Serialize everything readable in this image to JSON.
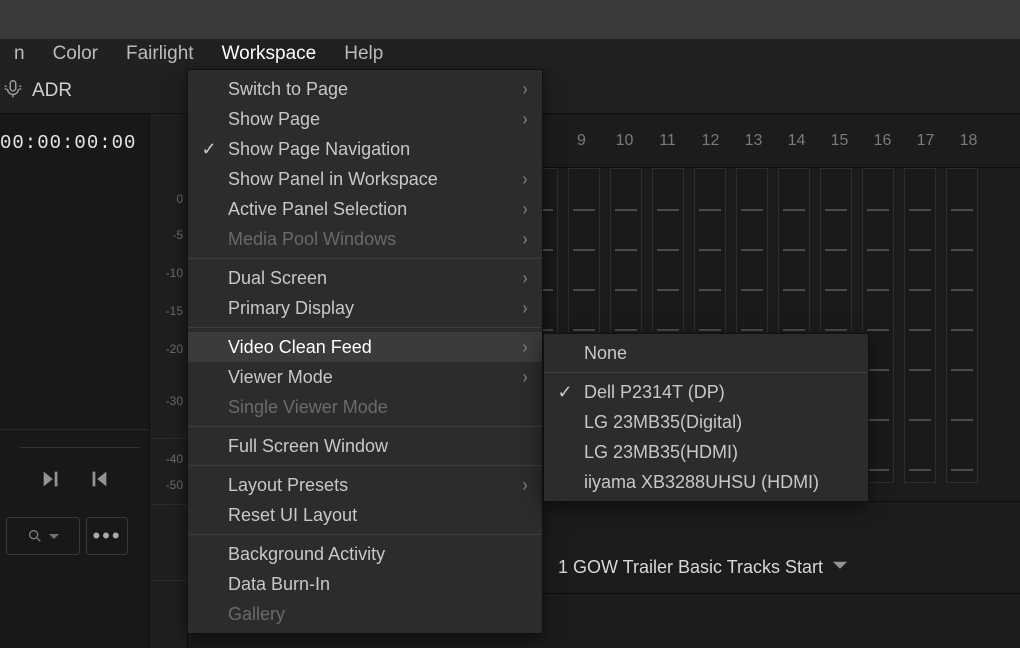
{
  "menubar": {
    "cropped_suffix": "n",
    "items": [
      "Color",
      "Fairlight",
      "Workspace",
      "Help"
    ],
    "active_index": 2
  },
  "toolbar": {
    "adr_label": "ADR"
  },
  "left": {
    "timecode": "00:00:00:00",
    "gutter_ticks": [
      "0",
      "-5",
      "-10",
      "-15",
      "-20",
      "-30",
      "-40",
      "-50"
    ]
  },
  "ruler": {
    "numbers": [
      "9",
      "10",
      "11",
      "12",
      "13",
      "14",
      "15",
      "16",
      "17",
      "18"
    ]
  },
  "session": {
    "label": "1 GOW Trailer Basic Tracks Start"
  },
  "workspace_menu": [
    {
      "label": "Switch to Page",
      "submenu": true
    },
    {
      "label": "Show Page",
      "submenu": true
    },
    {
      "label": "Show Page Navigation",
      "checked": true
    },
    {
      "label": "Show Panel in Workspace",
      "submenu": true
    },
    {
      "label": "Active Panel Selection",
      "submenu": true
    },
    {
      "label": "Media Pool Windows",
      "submenu": true,
      "disabled": true
    },
    {
      "sep": true
    },
    {
      "label": "Dual Screen",
      "submenu": true
    },
    {
      "label": "Primary Display",
      "submenu": true
    },
    {
      "sep": true
    },
    {
      "label": "Video Clean Feed",
      "submenu": true,
      "highlight": true
    },
    {
      "label": "Viewer Mode",
      "submenu": true
    },
    {
      "label": "Single Viewer Mode",
      "disabled": true
    },
    {
      "sep": true
    },
    {
      "label": "Full Screen Window"
    },
    {
      "sep": true
    },
    {
      "label": "Layout Presets",
      "submenu": true
    },
    {
      "label": "Reset UI Layout"
    },
    {
      "sep": true
    },
    {
      "label": "Background Activity"
    },
    {
      "label": "Data Burn-In"
    },
    {
      "label": "Gallery",
      "disabled": true
    }
  ],
  "video_clean_feed_submenu": [
    {
      "label": "None"
    },
    {
      "sep": true
    },
    {
      "label": "Dell P2314T (DP)",
      "checked": true
    },
    {
      "label": "LG 23MB35(Digital)"
    },
    {
      "label": "LG 23MB35(HDMI)"
    },
    {
      "label": "iiyama XB3288UHSU (HDMI)"
    }
  ]
}
